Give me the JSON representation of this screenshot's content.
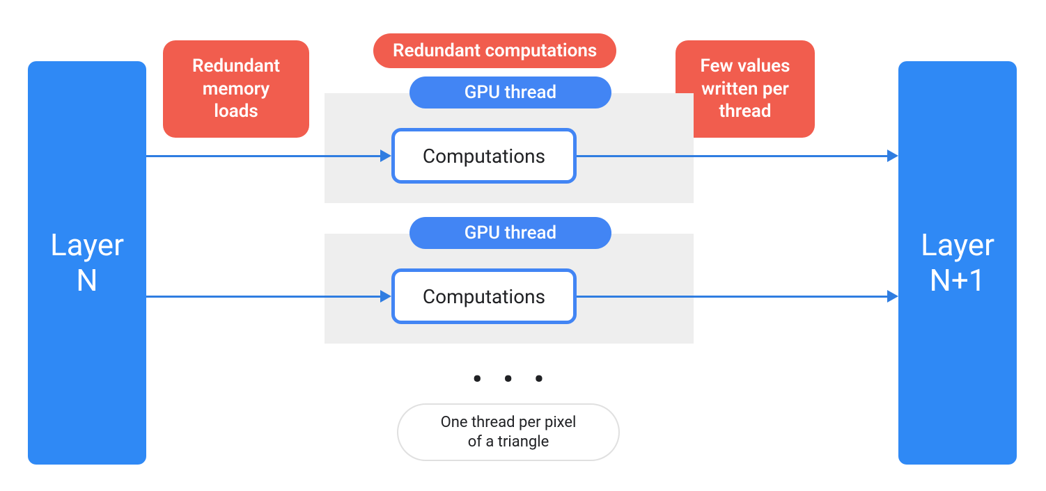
{
  "layers": {
    "left": {
      "line1": "Layer",
      "line2": "N"
    },
    "right": {
      "line1": "Layer",
      "line2": "N+1"
    }
  },
  "callouts": {
    "memory_loads": "Redundant\nmemory\nloads",
    "redundant_comp": "Redundant computations",
    "few_values": "Few values\nwritten per\nthread"
  },
  "threads": {
    "label": "GPU thread",
    "computation_label": "Computations"
  },
  "footer": {
    "ellipsis": "• • •",
    "caption": "One thread per pixel\nof a triangle"
  },
  "colors": {
    "blue": "#2f89f5",
    "red": "#f15d4e",
    "panel": "#eeeeee"
  }
}
